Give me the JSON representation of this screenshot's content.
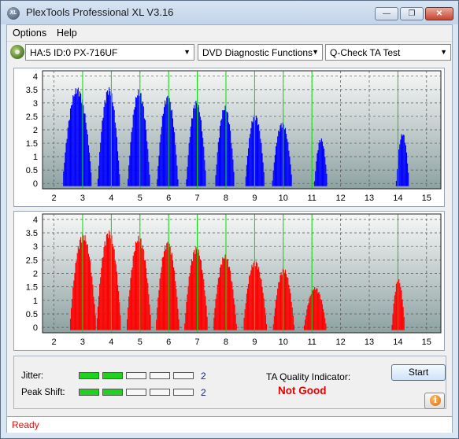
{
  "window": {
    "title": "PlexTools Professional XL V3.16",
    "icon_text": "XL",
    "minimize_glyph": "—",
    "maximize_glyph": "❐",
    "close_glyph": "✕"
  },
  "menu": {
    "items": [
      {
        "label": "Options"
      },
      {
        "label": "Help"
      }
    ]
  },
  "toolbar": {
    "drive": {
      "label": "HA:5 ID:0  PX-716UF",
      "icon": "disc-drive-icon"
    },
    "function": {
      "label": "DVD Diagnostic Functions"
    },
    "test": {
      "label": "Q-Check TA Test"
    }
  },
  "colors": {
    "upper_series": "#0000ff",
    "lower_series": "#ff0000",
    "marker_lines": "#00e000",
    "plot_bg_top": "#f7f7f7",
    "plot_bg_bottom": "#8ea2a2",
    "status_text": "#e01010",
    "ta_result": "#e00000"
  },
  "chart_data": [
    {
      "type": "area",
      "name": "upper-chart",
      "series_color": "blue",
      "x_ticks": [
        "2",
        "3",
        "4",
        "5",
        "6",
        "7",
        "8",
        "9",
        "10",
        "11",
        "12",
        "13",
        "14",
        "15"
      ],
      "y_ticks": [
        "0",
        "0.5",
        "1",
        "1.5",
        "2",
        "2.5",
        "3",
        "3.5",
        "4"
      ],
      "xlim": [
        1.6,
        15.5
      ],
      "ylim": [
        -0.2,
        4.2
      ],
      "grid": true,
      "markers_x": [
        3,
        4,
        5,
        6,
        7,
        8,
        9,
        10,
        11,
        14
      ],
      "peaks": [
        {
          "center": 2.8,
          "width": 0.5,
          "height": 3.6,
          "start": 2.3
        },
        {
          "center": 3.9,
          "width": 0.38,
          "height": 3.6
        },
        {
          "center": 4.95,
          "width": 0.38,
          "height": 3.5
        },
        {
          "center": 5.95,
          "width": 0.36,
          "height": 3.3
        },
        {
          "center": 6.95,
          "width": 0.34,
          "height": 3.1
        },
        {
          "center": 7.95,
          "width": 0.33,
          "height": 2.9
        },
        {
          "center": 9.0,
          "width": 0.33,
          "height": 2.6
        },
        {
          "center": 9.95,
          "width": 0.34,
          "height": 2.3
        },
        {
          "center": 11.3,
          "width": 0.22,
          "height": 1.7
        },
        {
          "center": 14.15,
          "width": 0.22,
          "height": 1.9
        }
      ]
    },
    {
      "type": "area",
      "name": "lower-chart",
      "series_color": "red",
      "x_ticks": [
        "2",
        "3",
        "4",
        "5",
        "6",
        "7",
        "8",
        "9",
        "10",
        "11",
        "12",
        "13",
        "14",
        "15"
      ],
      "y_ticks": [
        "0",
        "0.5",
        "1",
        "1.5",
        "2",
        "2.5",
        "3",
        "3.5",
        "4"
      ],
      "xlim": [
        1.6,
        15.5
      ],
      "ylim": [
        -0.2,
        4.2
      ],
      "grid": true,
      "markers_x": [
        3,
        4,
        5,
        6,
        7,
        8,
        9,
        10,
        11,
        14
      ],
      "peaks": [
        {
          "center": 3.0,
          "width": 0.45,
          "height": 3.5,
          "start": 2.5
        },
        {
          "center": 3.9,
          "width": 0.42,
          "height": 3.6
        },
        {
          "center": 4.95,
          "width": 0.42,
          "height": 3.4
        },
        {
          "center": 5.95,
          "width": 0.4,
          "height": 3.2
        },
        {
          "center": 6.95,
          "width": 0.4,
          "height": 3.0
        },
        {
          "center": 7.95,
          "width": 0.4,
          "height": 2.7
        },
        {
          "center": 9.0,
          "width": 0.4,
          "height": 2.5
        },
        {
          "center": 10.0,
          "width": 0.36,
          "height": 2.2
        },
        {
          "center": 11.1,
          "width": 0.38,
          "height": 1.5
        },
        {
          "center": 14.0,
          "width": 0.22,
          "height": 1.8
        }
      ]
    }
  ],
  "bottom_panel": {
    "jitter": {
      "label": "Jitter:",
      "value": "2",
      "segments_total": 5,
      "segments_filled": 2
    },
    "peak_shift": {
      "label": "Peak Shift:",
      "value": "2",
      "segments_total": 5,
      "segments_filled": 2
    },
    "ta_quality": {
      "label": "TA Quality Indicator:",
      "result": "Not Good"
    },
    "start_button": {
      "label": "Start"
    },
    "info_button": {
      "icon": "info-icon",
      "glyph": "i"
    }
  },
  "status": {
    "text": "Ready"
  }
}
